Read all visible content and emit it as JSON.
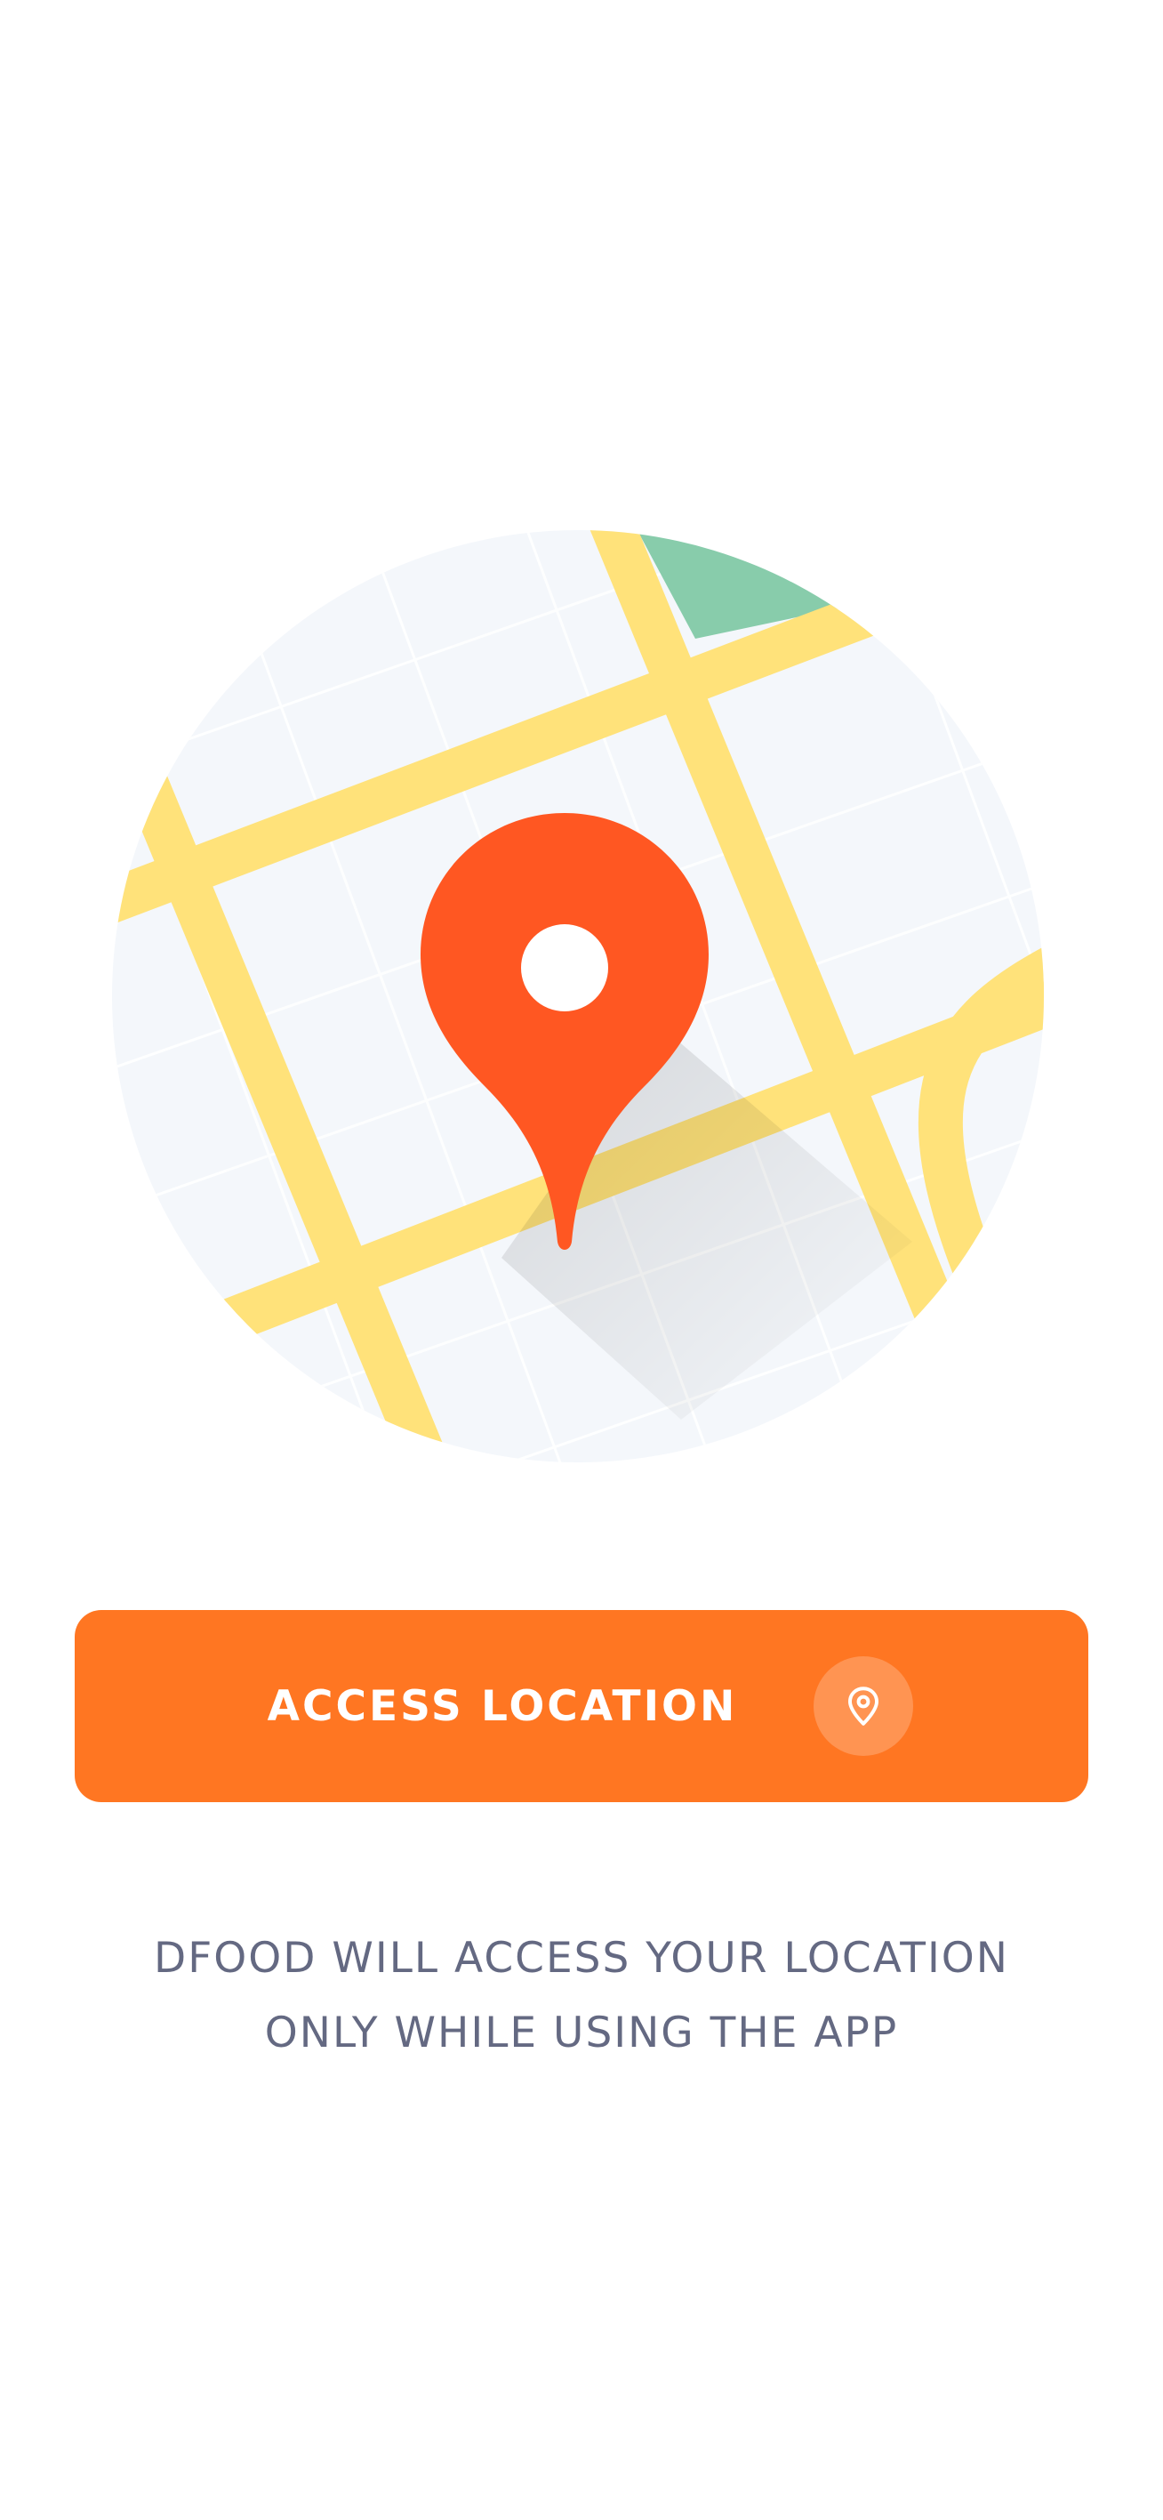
{
  "illustration": {
    "icon": "map-pin-icon",
    "colors": {
      "background": "#F4F7FB",
      "road": "#FFE27A",
      "park": "#88CCAB",
      "pin": "#FF5722",
      "grid": "#FFFFFF"
    }
  },
  "primary_action": {
    "label": "ACCESS LOCATION",
    "icon": "location-pin-icon",
    "color": "#FF7622"
  },
  "info": {
    "line1": "DFOOD WILL ACCESS YOUR LOCATION",
    "line2": "ONLY WHILE USING THE APP",
    "color": "#646982"
  }
}
